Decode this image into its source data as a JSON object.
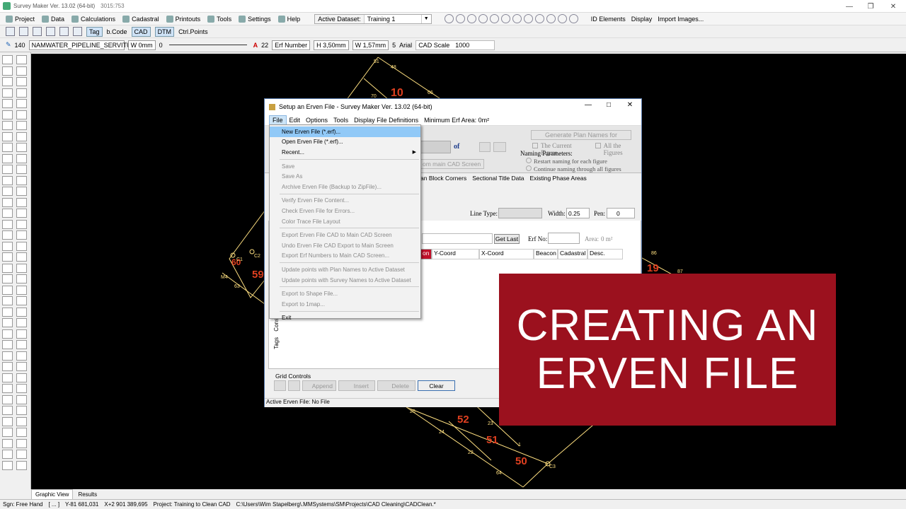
{
  "app": {
    "title": "Survey Maker Ver. 13.02 (64-bit)",
    "coords": "3015:753"
  },
  "menu_bar": {
    "items": [
      "Project",
      "Data",
      "Calculations",
      "Cadastral",
      "Printouts",
      "Tools",
      "Settings",
      "Help"
    ],
    "dataset_label": "Active Dataset:",
    "dataset_value": "Training 1",
    "right_items": [
      "ID Elements",
      "Display",
      "Import Images..."
    ]
  },
  "toolbar2": {
    "tag": "Tag",
    "bcode": "b.Code",
    "cad": "CAD",
    "dtm": "DTM",
    "ctrl_points": "Ctrl.Points"
  },
  "toolbar3": {
    "pen_num": "140",
    "layer": "NAMWATER_PIPELINE_SERVITUDE",
    "width": "W 0mm",
    "line_num": "0",
    "text_size": "22",
    "erf_number": "Erf Number",
    "height": "H 3,50mm",
    "width2": "W 1,57mm",
    "num5": "5",
    "font": "Arial",
    "cad_scale_label": "CAD Scale",
    "cad_scale": "1000"
  },
  "dialog": {
    "title": "Setup an Erven File - Survey Maker Ver. 13.02 (64-bit)",
    "menu": [
      "File",
      "Edit",
      "Options",
      "Tools",
      "Display File Definitions",
      "Minimum Erf Area: 0m²"
    ],
    "generate_button": "Generate Plan Names for",
    "current_figure": "The Current Figure",
    "all_figures": "All the Figures",
    "naming_params": "Naming Parameters:",
    "restart_naming": "Restart naming for each figure",
    "continue_naming": "Continue naming through all figures",
    "of_label": "of",
    "main_cad": "om main CAD Screen",
    "tabs": [
      "an Block Corners",
      "Sectional Title Data",
      "Existing Phase Areas"
    ],
    "line_type": "Line Type:",
    "width_label": "Width:",
    "width_val": "0.25",
    "pen_label": "Pen:",
    "pen_val": "0",
    "get_last": "Get Last",
    "erf_no": "Erf No:",
    "area_label": "Area:",
    "area_val": "0 m²",
    "columns": [
      "on",
      "Y-Coord",
      "X-Coord",
      "Beacon",
      "Cadastral",
      "Desc."
    ],
    "side_tabs": [
      "Tags",
      "Cons"
    ],
    "grid_controls": "Grid Controls",
    "append": "Append",
    "insert": "Insert",
    "delete": "Delete",
    "clear": "Clear",
    "status": "Active Erven File: No File"
  },
  "file_menu": {
    "items": [
      {
        "label": "New Erven File (*.erf)...",
        "enabled": true,
        "highlight": true
      },
      {
        "label": "Open Erven File (*.erf)...",
        "enabled": true
      },
      {
        "label": "Recent...",
        "enabled": true,
        "submenu": true
      },
      {
        "sep": true
      },
      {
        "label": "Save",
        "enabled": false
      },
      {
        "label": "Save As",
        "enabled": false
      },
      {
        "label": "Archive Erven File (Backup to ZipFile)...",
        "enabled": false
      },
      {
        "sep": true
      },
      {
        "label": "Verify Erven File Content...",
        "enabled": false
      },
      {
        "label": "Check Erven File for Errors...",
        "enabled": false
      },
      {
        "label": "Color Trace File Layout",
        "enabled": false
      },
      {
        "sep": true
      },
      {
        "label": "Export Erven File CAD to Main CAD Screen",
        "enabled": false
      },
      {
        "label": "Undo Erven File CAD Export to Main Screen",
        "enabled": false
      },
      {
        "label": "Export Erf Numbers to Main CAD Screen...",
        "enabled": false
      },
      {
        "sep": true
      },
      {
        "label": "Update points with Plan Names to Active Dataset",
        "enabled": false
      },
      {
        "label": "Update points with Survey Names to Active Dataset",
        "enabled": false
      },
      {
        "sep": true
      },
      {
        "label": "Export to Shape File...",
        "enabled": false
      },
      {
        "label": "Export to 1map...",
        "enabled": false
      },
      {
        "sep": true
      },
      {
        "label": "Exit",
        "enabled": true
      }
    ]
  },
  "banner": {
    "line1": "CREATING AN",
    "line2": "ERVEN FILE",
    "color": "#9b111e"
  },
  "cad": {
    "labels": [
      "10",
      "59",
      "60",
      "19",
      "52",
      "51",
      "50"
    ],
    "points": [
      "51",
      "48",
      "70",
      "66",
      "M4",
      "63",
      "C1",
      "C2",
      "26",
      "24",
      "23",
      "22",
      "1",
      "64",
      "C3",
      "86",
      "87"
    ]
  },
  "bottom_tabs": [
    "Graphic View",
    "Results"
  ],
  "status_bar": {
    "mode": "Sgn: Free Hand",
    "bracket": "[ ... ]",
    "y": "Y-81 681,031",
    "x": "X+2 901 389,695",
    "project": "Project: Training to Clean CAD",
    "path": "C:\\Users\\Wim Stapelberg\\.MMSystems\\SM\\Projects\\CAD Cleaning\\CADClean.*"
  }
}
